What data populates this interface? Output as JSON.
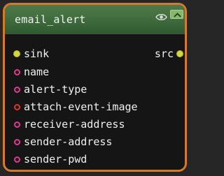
{
  "node": {
    "title": "email_alert",
    "header_color": "#3e6a3d",
    "border_color": "#d8792a",
    "icons": {
      "visibility": "eye-icon",
      "collapse": "chevron-up-icon"
    }
  },
  "pads": {
    "sink": {
      "label": "sink",
      "color": "#d6d63a"
    },
    "src": {
      "label": "src",
      "color": "#d6d63a"
    }
  },
  "properties": [
    {
      "label": "name",
      "color": "#e0398e"
    },
    {
      "label": "alert-type",
      "color": "#e0398e"
    },
    {
      "label": "attach-event-image",
      "color": "#e3342f"
    },
    {
      "label": "receiver-address",
      "color": "#e0398e"
    },
    {
      "label": "sender-address",
      "color": "#e0398e"
    },
    {
      "label": "sender-pwd",
      "color": "#e0398e"
    }
  ]
}
